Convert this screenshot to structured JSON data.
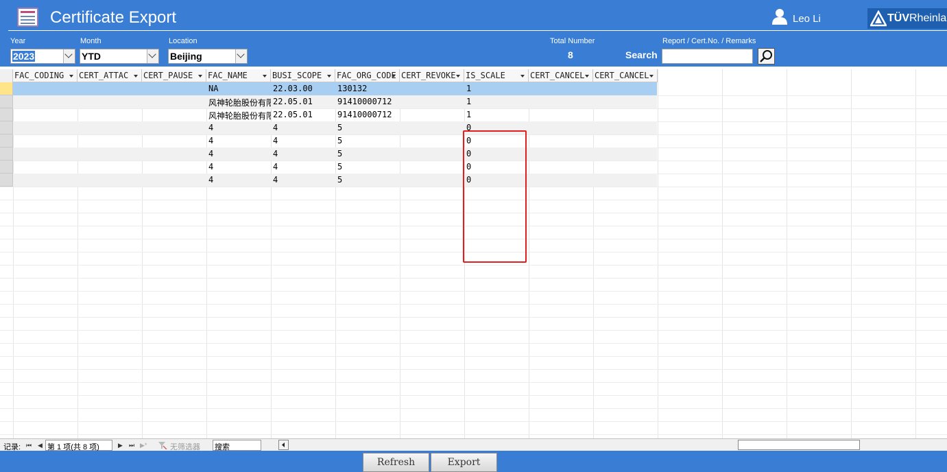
{
  "app": {
    "title": "Certificate Export",
    "user": "Leo Li",
    "logo_text_bold": "TÜV",
    "logo_text": "Rheinla"
  },
  "filters": {
    "year": {
      "label": "Year",
      "value": "2023"
    },
    "month": {
      "label": "Month",
      "value": "YTD"
    },
    "location": {
      "label": "Location",
      "value": "Beijing"
    },
    "total_label": "Total Number",
    "total_value": "8",
    "search_label": "Search",
    "search_field_label": "Report / Cert.No. / Remarks",
    "search_value": ""
  },
  "grid": {
    "columns": [
      "FAC_CODING",
      "CERT_ATTAC",
      "CERT_PAUSE",
      "FAC_NAME",
      "BUSI_SCOPE",
      "FAC_ORG_CODE",
      "CERT_REVOKE",
      "IS_SCALE",
      "CERT_CANCEL",
      "CERT_CANCEL"
    ],
    "rows": [
      [
        "",
        "",
        "",
        "NA",
        "22.03.00",
        "130132",
        "",
        "1",
        "",
        ""
      ],
      [
        "",
        "",
        "",
        "风神轮胎股份有限公司",
        "22.05.01",
        "91410000712",
        "",
        "1",
        "",
        ""
      ],
      [
        "",
        "",
        "",
        "风神轮胎股份有限公司",
        "22.05.01",
        "91410000712",
        "",
        "1",
        "",
        ""
      ],
      [
        "",
        "",
        "",
        "4",
        "4",
        "5",
        "",
        "0",
        "",
        ""
      ],
      [
        "",
        "",
        "",
        "4",
        "4",
        "5",
        "",
        "0",
        "",
        ""
      ],
      [
        "",
        "",
        "",
        "4",
        "4",
        "5",
        "",
        "0",
        "",
        ""
      ],
      [
        "",
        "",
        "",
        "4",
        "4",
        "5",
        "",
        "0",
        "",
        ""
      ],
      [
        "",
        "",
        "",
        "4",
        "4",
        "5",
        "",
        "0",
        "",
        ""
      ]
    ],
    "current_row": 0,
    "highlighted_column": "IS_SCALE",
    "highlight_color": "#e31e1e"
  },
  "navigator": {
    "label": "记录:",
    "first": "⏮",
    "prev": "◀",
    "position": "第 1 项(共 8 项)",
    "next": "▶",
    "last": "⏭",
    "new": "▶*",
    "filter_label": "无筛选器",
    "search_placeholder": "搜索"
  },
  "footer": {
    "refresh": "Refresh",
    "export": "Export"
  },
  "colors": {
    "header_bg": "#3a7dd4",
    "current_row": "#a8cff2",
    "alt_row": "#f1f1f1"
  }
}
